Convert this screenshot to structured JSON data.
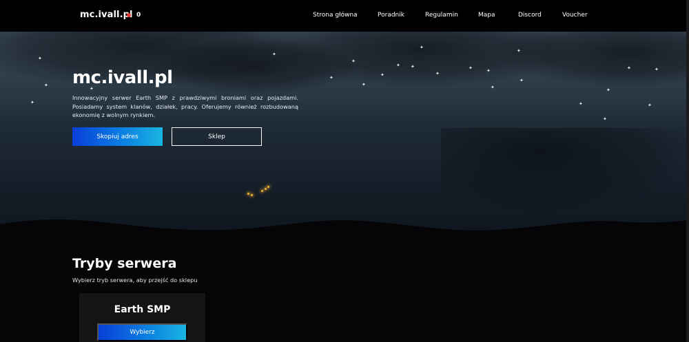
{
  "nav": {
    "logo": "mc.ivall.pl",
    "online_count": "0",
    "online_color": "#e53935",
    "links": [
      {
        "label": "Strona główna"
      },
      {
        "label": "Poradnik"
      },
      {
        "label": "Regulamin"
      },
      {
        "label": "Mapa"
      },
      {
        "label": "Discord"
      },
      {
        "label": "Voucher"
      }
    ]
  },
  "hero": {
    "title": "mc.ivall.pl",
    "description": "Innowacyjny serwer Earth SMP z prawdziwymi broniami oraz pojazdami. Posiadamy system klanów, działek, pracy. Oferujemy również rozbudowaną ekonomię z wolnym rynkiem.",
    "copy_button": "Skopiuj adres",
    "shop_button": "Sklep"
  },
  "modes": {
    "title": "Tryby serwera",
    "subtitle": "Wybierz tryb serwera, aby przejść do sklepu",
    "cards": [
      {
        "name": "Earth SMP",
        "button": "Wybierz"
      }
    ]
  },
  "colors": {
    "accent_gradient_start": "#0a3fd8",
    "accent_gradient_end": "#19b5e0",
    "background": "#050507"
  }
}
